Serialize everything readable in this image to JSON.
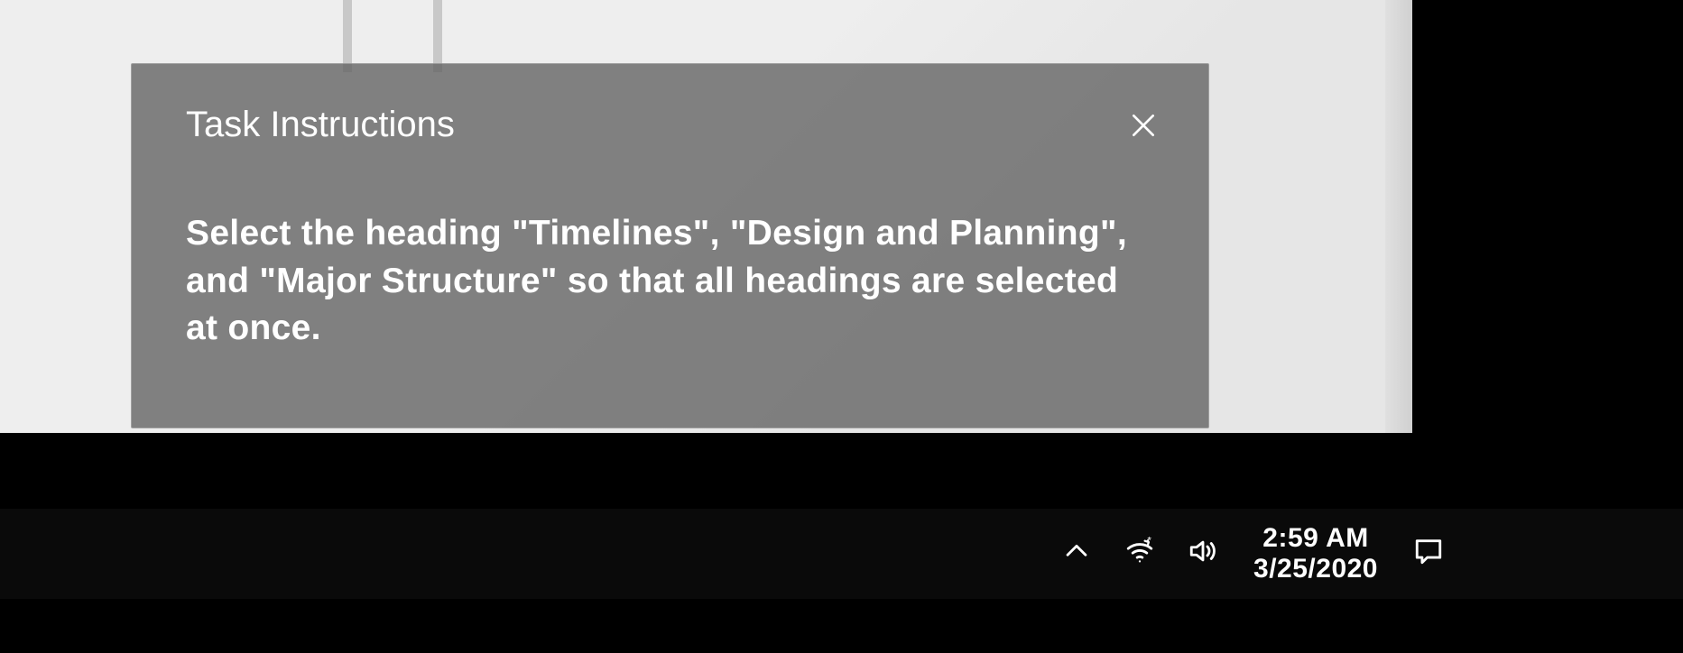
{
  "dialog": {
    "title": "Task Instructions",
    "body": "Select the heading \"Timelines\", \"Design and Planning\", and \"Major Structure\" so that all headings are selected at once."
  },
  "taskbar": {
    "time": "2:59 AM",
    "date": "3/25/2020"
  }
}
